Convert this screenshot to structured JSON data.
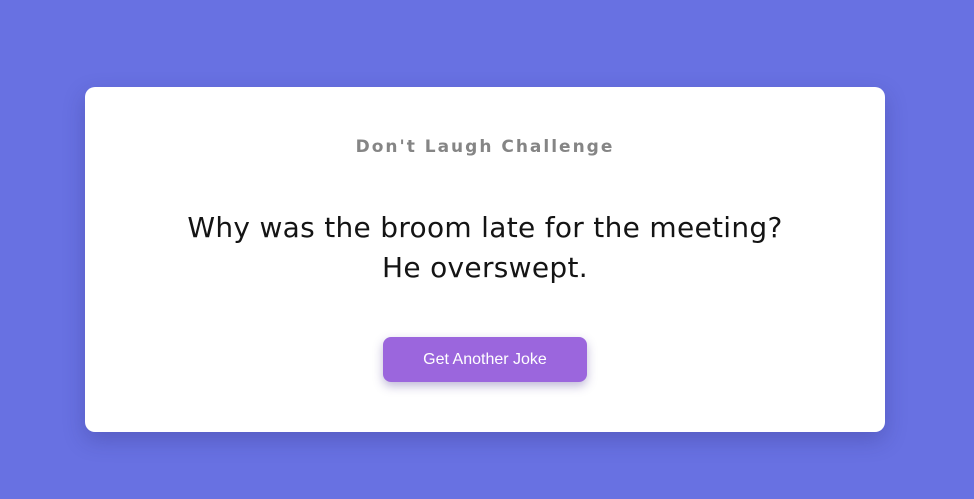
{
  "app": {
    "title": "Don't Laugh Challenge"
  },
  "joke": {
    "setup": "Why was the broom late for the meeting?",
    "punchline": "He overswept."
  },
  "actions": {
    "next_label": "Get Another Joke"
  },
  "colors": {
    "background": "#6871e2",
    "card": "#ffffff",
    "title": "#858585",
    "button": "#9b66dd",
    "button_text": "#ffffff",
    "joke_text": "#141414"
  }
}
